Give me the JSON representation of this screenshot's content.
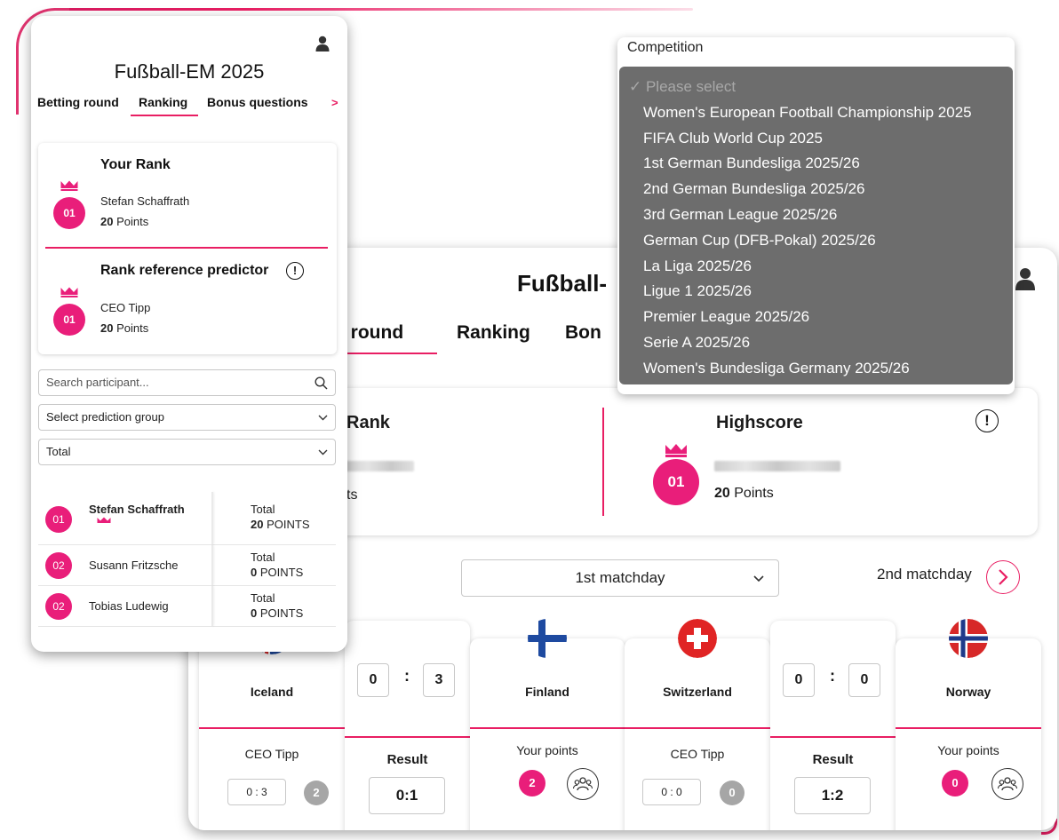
{
  "front_card": {
    "title": "Fußball-EM 2025",
    "tabs": [
      {
        "label": "Betting round"
      },
      {
        "label": "Ranking"
      },
      {
        "label": "Bonus questions"
      }
    ],
    "tabs_more": ">",
    "your_rank": {
      "heading": "Your Rank",
      "rank": "01",
      "name": "Stefan Schaffrath",
      "points_value": "20",
      "points_label": "Points"
    },
    "reference": {
      "heading": "Rank reference predictor",
      "info": "!",
      "rank": "01",
      "name": "CEO Tipp",
      "points_value": "20",
      "points_label": "Points"
    },
    "search_placeholder": "Search participant...",
    "group_select": "Select prediction group",
    "period_select": "Total",
    "ranking": [
      {
        "rank": "01",
        "name": "Stefan Schaffrath",
        "total_label": "Total",
        "points_value": "20",
        "points_label": "POINTS"
      },
      {
        "rank": "02",
        "name": "Susann Fritzsche",
        "total_label": "Total",
        "points_value": "0",
        "points_label": "POINTS"
      },
      {
        "rank": "02",
        "name": "Tobias Ludewig",
        "total_label": "Total",
        "points_value": "0",
        "points_label": "POINTS"
      }
    ]
  },
  "back_card": {
    "title": "Fußball-",
    "tabs": [
      {
        "label": "g round"
      },
      {
        "label": "Ranking"
      },
      {
        "label": "Bon"
      }
    ],
    "rank_label": "Rank",
    "rank_points_fragment": "ts",
    "highscore": {
      "title": "Highscore",
      "info": "!",
      "rank": "01",
      "points_value": "20",
      "points_label": "Points"
    },
    "matchday_select": "1st matchday",
    "next_matchday": "2nd matchday",
    "matches": [
      {
        "home": "Iceland",
        "away": "Finland",
        "home_tip": "0",
        "away_tip": "3",
        "colon": ":",
        "result_label": "Result",
        "result": "0:1",
        "ceo_label": "CEO Tipp",
        "ceo_tip": "0 : 3",
        "ceo_points": "2",
        "your_points_label": "Your points",
        "your_points": "2"
      },
      {
        "home": "Switzerland",
        "away": "Norway",
        "home_tip": "0",
        "away_tip": "0",
        "colon": ":",
        "result_label": "Result",
        "result": "1:2",
        "ceo_label": "CEO Tipp",
        "ceo_tip": "0 : 0",
        "ceo_points": "0",
        "your_points_label": "Your points",
        "your_points": "0"
      }
    ]
  },
  "competition": {
    "label": "Competition",
    "placeholder": "✓ Please select",
    "options": [
      "Women's European Football Championship 2025",
      "FIFA Club World Cup 2025",
      "1st German Bundesliga 2025/26",
      "2nd German Bundesliga 2025/26",
      "3rd German League 2025/26",
      "German Cup (DFB-Pokal) 2025/26",
      "La Liga 2025/26",
      "Ligue 1 2025/26",
      "Premier League 2025/26",
      "Serie A 2025/26",
      "Women's Bundesliga Germany 2025/26"
    ]
  },
  "colors": {
    "accent": "#e91e63",
    "badge": "#e91e7a",
    "dropdown_bg": "#6d6d6d",
    "badge_gray": "#a6a6a6"
  },
  "icons": [
    "user-icon",
    "search-icon",
    "chevron-down-icon",
    "chevron-right-icon",
    "crown-icon",
    "info-icon",
    "group-icon",
    "flag-iceland-icon",
    "flag-finland-icon",
    "flag-switzerland-icon",
    "flag-norway-icon"
  ]
}
